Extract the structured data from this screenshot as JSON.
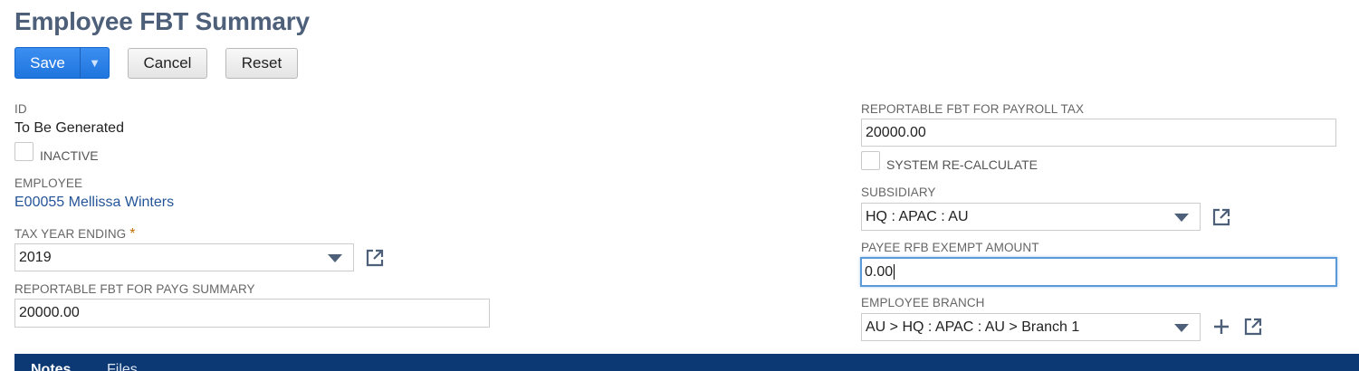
{
  "page": {
    "title": "Employee FBT Summary"
  },
  "toolbar": {
    "save_label": "Save",
    "save_menu_icon": "triangle-down",
    "cancel_label": "Cancel",
    "reset_label": "Reset"
  },
  "fields": {
    "id": {
      "label": "ID",
      "value": "To Be Generated"
    },
    "inactive": {
      "label": "INACTIVE",
      "checked": false
    },
    "employee": {
      "label": "EMPLOYEE",
      "value": "E00055 Mellissa Winters"
    },
    "tax_year_ending": {
      "label": "TAX YEAR ENDING",
      "required_mark": "*",
      "value": "2019"
    },
    "reportable_fbt_payg": {
      "label": "REPORTABLE FBT FOR PAYG SUMMARY",
      "value": "20000.00"
    },
    "reportable_fbt_payroll": {
      "label": "REPORTABLE FBT FOR PAYROLL TAX",
      "value": "20000.00"
    },
    "system_recalculate": {
      "label": "SYSTEM RE-CALCULATE",
      "checked": false
    },
    "subsidiary": {
      "label": "SUBSIDIARY",
      "value": "HQ : APAC : AU"
    },
    "payee_rfb_exempt": {
      "label": "PAYEE RFB EXEMPT AMOUNT",
      "value": "0.00"
    },
    "employee_branch": {
      "label": "EMPLOYEE BRANCH",
      "value": "AU > HQ : APAC : AU > Branch 1"
    }
  },
  "tabs": [
    {
      "label": "Notes"
    },
    {
      "label": "Files"
    }
  ],
  "colors": {
    "title": "#4d5f79",
    "primary_button": "#1f75de",
    "link": "#255599",
    "tabbar": "#0c3974",
    "required": "#c26d00"
  }
}
